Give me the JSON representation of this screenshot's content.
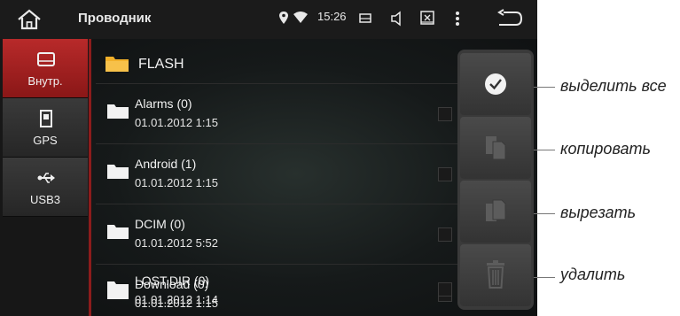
{
  "topbar": {
    "title": "Проводник",
    "time": "15:26"
  },
  "sidebar": {
    "tabs": [
      {
        "label": "Внутр.",
        "icon": "hdd-icon",
        "active": true
      },
      {
        "label": "GPS",
        "icon": "sd-card-icon",
        "active": false
      },
      {
        "label": "USB3",
        "icon": "usb-icon",
        "active": false
      }
    ]
  },
  "folder": {
    "name": "FLASH"
  },
  "files": [
    {
      "name": "Alarms (0)",
      "date": "01.01.2012 1:15"
    },
    {
      "name": "Android (1)",
      "date": "01.01.2012 1:15"
    },
    {
      "name": "DCIM (0)",
      "date": "01.01.2012 5:52"
    },
    {
      "name": "Download (0)",
      "date": "01.01.2012 1:15"
    },
    {
      "name": "LOST.DIR (0)",
      "date": "01.01.2012 1:14"
    }
  ],
  "callouts": {
    "select_all": "выделить все",
    "copy": "копировать",
    "cut": "вырезать",
    "delete": "удалить"
  },
  "colors": {
    "accent": "#b82a2a",
    "background": "#111315"
  }
}
